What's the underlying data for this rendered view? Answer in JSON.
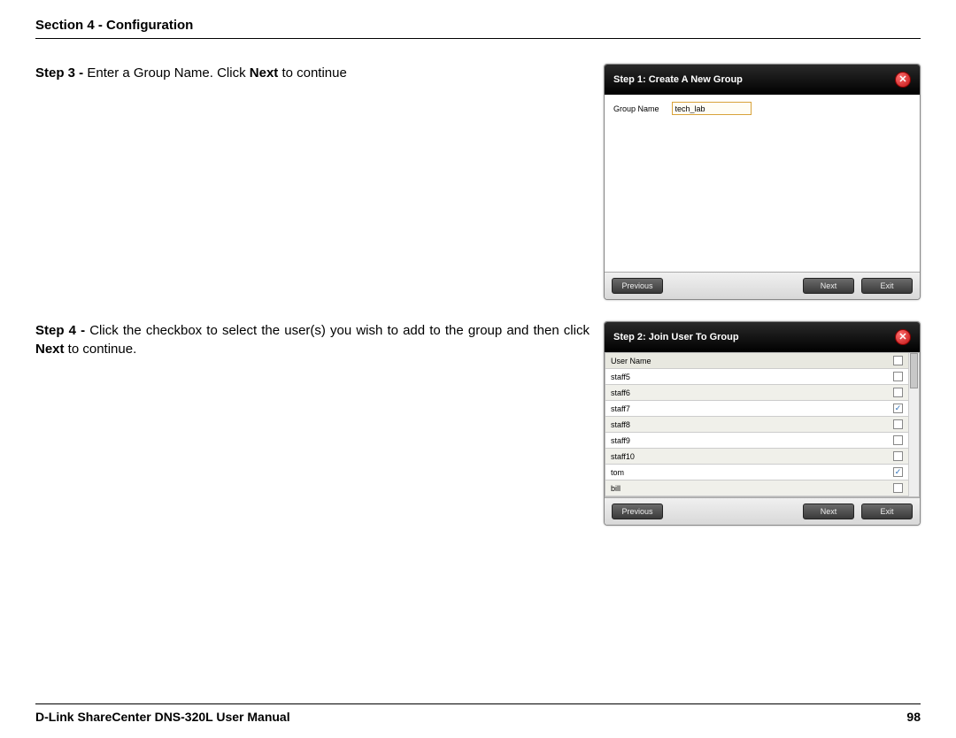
{
  "header": {
    "title": "Section 4 - Configuration"
  },
  "step3": {
    "prefix": "Step 3 - ",
    "text1": "Enter a Group Name. Click ",
    "bold1": "Next",
    "text2": " to continue"
  },
  "step4": {
    "prefix": "Step 4 - ",
    "text1": "Click the checkbox to select the user(s) you wish to add to the group and then click ",
    "bold1": "Next",
    "text2": " to continue."
  },
  "dialog1": {
    "title": "Step 1: Create A New Group",
    "group_name_label": "Group Name",
    "group_name_value": "tech_lab",
    "prev": "Previous",
    "next": "Next",
    "exit": "Exit"
  },
  "dialog2": {
    "title": "Step 2: Join User To Group",
    "header_col": "User Name",
    "users": [
      {
        "name": "staff5",
        "checked": false
      },
      {
        "name": "staff6",
        "checked": false
      },
      {
        "name": "staff7",
        "checked": true
      },
      {
        "name": "staff8",
        "checked": false
      },
      {
        "name": "staff9",
        "checked": false
      },
      {
        "name": "staff10",
        "checked": false
      },
      {
        "name": "tom",
        "checked": true
      },
      {
        "name": "bill",
        "checked": false
      }
    ],
    "prev": "Previous",
    "next": "Next",
    "exit": "Exit"
  },
  "footer": {
    "manual": "D-Link ShareCenter DNS-320L User Manual",
    "page": "98"
  }
}
